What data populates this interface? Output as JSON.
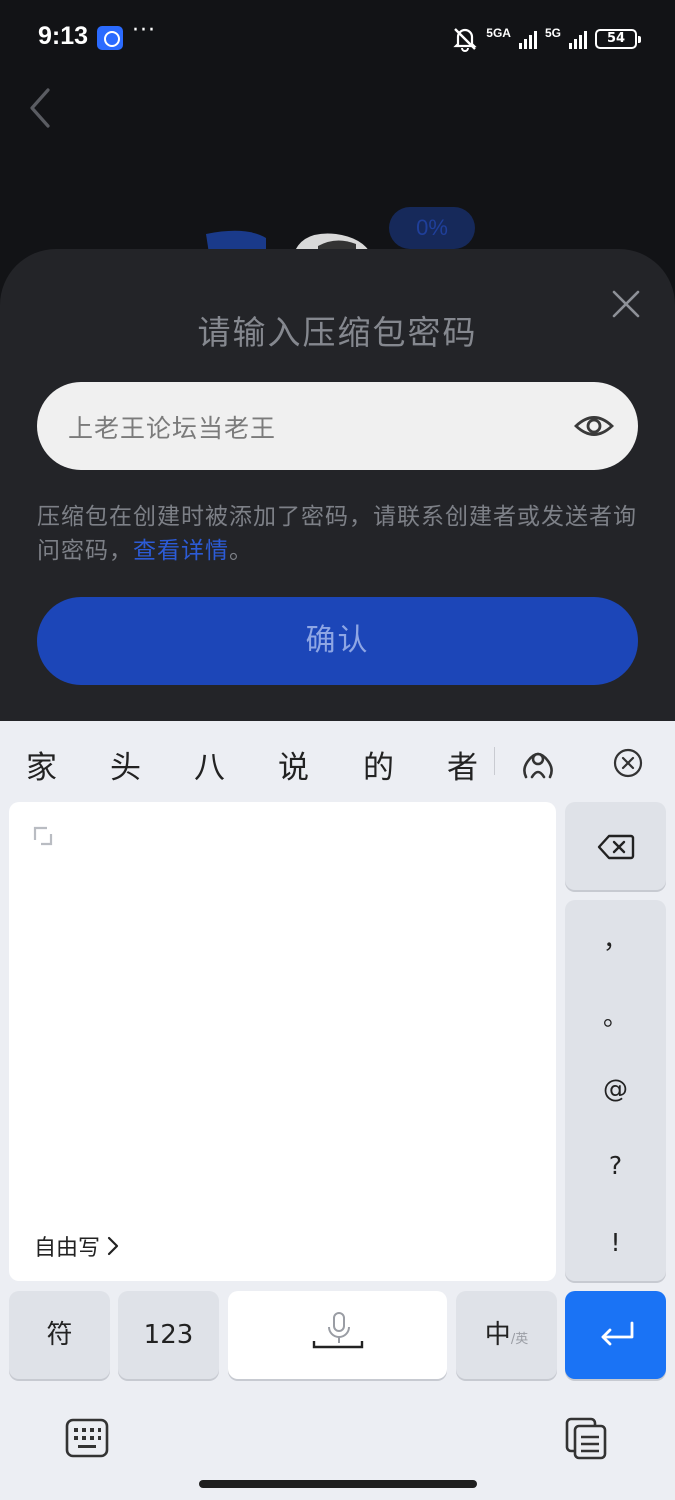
{
  "status_bar": {
    "time": "9:13",
    "more": "···",
    "network_1": "5GA",
    "network_2": "5G",
    "battery": "54"
  },
  "background": {
    "progress": "0%"
  },
  "dialog": {
    "title": "请输入压缩包密码",
    "password_value": "上老王论坛当老王",
    "hint_text": "压缩包在创建时被添加了密码，请联系创建者或发送者询问密码，",
    "hint_link": "查看详情",
    "hint_end": "。",
    "confirm_label": "确认"
  },
  "keyboard": {
    "candidates": [
      "家",
      "头",
      "八",
      "说",
      "的",
      "者"
    ],
    "free_write_label": "自由写",
    "punctuation": [
      "，",
      "。",
      "@",
      "?",
      "!"
    ],
    "symbols_key": "符",
    "numbers_key": "123",
    "lang_main": "中",
    "lang_sub": "/英"
  },
  "colors": {
    "dialog_bg": "#232428",
    "confirm_bg": "#1c46b8",
    "link": "#2c5bd6",
    "enter_key": "#1a73f5"
  }
}
